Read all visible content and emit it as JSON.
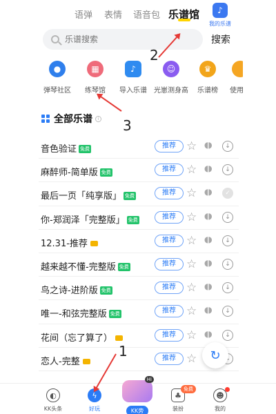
{
  "top_tabs": {
    "items": [
      "语弹",
      "表情",
      "语音包"
    ],
    "active": "乐谱馆",
    "my_scores": "我的乐谱"
  },
  "search": {
    "placeholder": "乐谱搜索",
    "button": "搜索"
  },
  "categories": [
    {
      "label": "弹琴社区",
      "icon": "planet-icon",
      "color": "#2f7fec"
    },
    {
      "label": "练琴馆",
      "icon": "piano-icon",
      "color": "#ef6b7a"
    },
    {
      "label": "导入乐谱",
      "icon": "music-note-icon",
      "color": "#2f8bf0"
    },
    {
      "label": "光崽测身高",
      "icon": "person-icon",
      "color": "#8a5cf0"
    },
    {
      "label": "乐谱榜",
      "icon": "trophy-icon",
      "color": "#f2a51a"
    },
    {
      "label": "使用",
      "icon": "partial-icon",
      "color": "#f5a623"
    }
  ],
  "section": {
    "title": "全部乐谱",
    "info": "i"
  },
  "songs": [
    {
      "title": "音色验证",
      "tag": "免费",
      "action": "推荐",
      "downloaded": false
    },
    {
      "title": "麻醉师-简单版",
      "tag": "免费",
      "action": "推荐",
      "downloaded": false
    },
    {
      "title": "最后一页「纯享版」",
      "tag": "免费",
      "action": "推荐",
      "downloaded": true
    },
    {
      "title": "你-郑润泽「完整版」",
      "tag": "免费",
      "action": "推荐",
      "downloaded": false
    },
    {
      "title": "12.31-推荐",
      "tag": "vip",
      "action": "推荐",
      "downloaded": false
    },
    {
      "title": "越来越不懂-完整版",
      "tag": "免费",
      "action": "推荐",
      "downloaded": false
    },
    {
      "title": "鸟之诗-进阶版",
      "tag": "免费",
      "action": "推荐",
      "downloaded": false
    },
    {
      "title": "唯一-和弦完整版",
      "tag": "免费",
      "action": "推荐",
      "downloaded": false
    },
    {
      "title": "花间（忘了算了）",
      "tag": "vip",
      "action": "推荐",
      "downloaded": false
    },
    {
      "title": "恋人-完整",
      "tag": "vip",
      "action": "推荐",
      "downloaded": false
    }
  ],
  "bottom_nav": {
    "items": [
      "KK头条",
      "好玩",
      "装扮",
      "我的"
    ],
    "center_label": "KK旁",
    "center_hi": "Hi",
    "free_tag": "免费"
  },
  "annotations": [
    "1",
    "2",
    "3"
  ],
  "colors": {
    "accent": "#2b7cf6",
    "free": "#22c36a",
    "arrow": "#e53935"
  }
}
